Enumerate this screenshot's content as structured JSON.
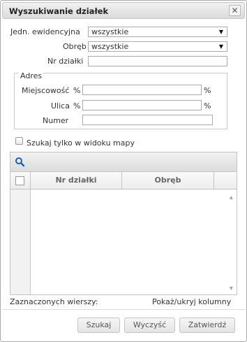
{
  "dialog": {
    "title": "Wyszukiwanie działek",
    "close_glyph": "✕"
  },
  "form": {
    "jedn_label": "Jedn. ewidencyjna",
    "jedn_value": "wszystkie",
    "obreb_label": "Obręb",
    "obreb_value": "wszystkie",
    "nr_label": "Nr działki",
    "nr_value": ""
  },
  "adres": {
    "legend": "Adres",
    "miejscowosc_label": "Miejscowość",
    "ulica_label": "Ulica",
    "numer_label": "Numer",
    "percent": "%"
  },
  "options": {
    "map_only_label": "Szukaj tylko w widoku mapy",
    "map_only_checked": false
  },
  "grid": {
    "toolbar_icon": "search-icon",
    "columns": [
      "Nr działki",
      "Obręb"
    ],
    "rows": [],
    "selected_label": "Zaznaczonych wierszy:",
    "toggle_columns_label": "Pokaż/ukryj kolumny"
  },
  "buttons": {
    "search": "Szukaj",
    "clear": "Wyczyść",
    "confirm": "Zatwierdź"
  },
  "colors": {
    "accent": "#1a5fb4",
    "border": "#c4c4c4"
  }
}
